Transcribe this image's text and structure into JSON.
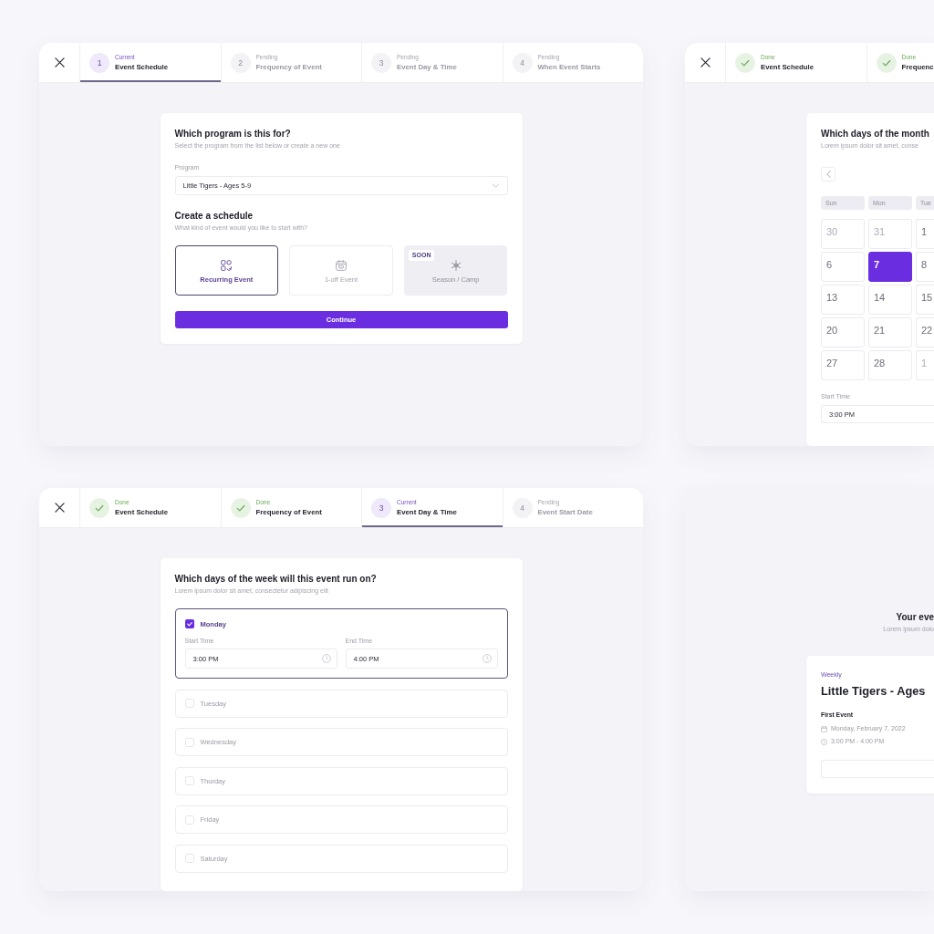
{
  "screens": [
    {
      "kind": "program",
      "steps": [
        {
          "done": false,
          "selected": true,
          "number": "1",
          "status": "Current",
          "label": "Event Schedule"
        },
        {
          "done": false,
          "selected": false,
          "number": "2",
          "status": "Pending",
          "label": "Frequency of Event"
        },
        {
          "done": false,
          "selected": false,
          "number": "3",
          "status": "Pending",
          "label": "Event Day & Time"
        },
        {
          "done": false,
          "selected": false,
          "number": "4",
          "status": "Pending",
          "label": "When Event Starts"
        }
      ],
      "title": "Which program is this for?",
      "subtitle": "Select the program from the list below or create a new one",
      "program": {
        "label": "Program",
        "value": "Little Tigers - Ages 5-9"
      },
      "schedule_title": "Create a schedule",
      "schedule_subtitle": "What kind of event would you like to start with?",
      "options": [
        {
          "kind": "recurring",
          "label": "Recurring Event",
          "selected": true,
          "disabled": false
        },
        {
          "kind": "single",
          "label": "1-off Event",
          "selected": false,
          "disabled": false
        },
        {
          "kind": "season",
          "label": "Season / Camp",
          "selected": false,
          "disabled": true,
          "badge": "SOON"
        }
      ],
      "button": "Continue"
    },
    {
      "kind": "month",
      "steps": [
        {
          "done": true,
          "selected": false,
          "status": "Done",
          "label": "Event Schedule"
        },
        {
          "done": true,
          "selected": false,
          "status": "Done",
          "label": "Frequenc"
        }
      ],
      "title": "Which days of the month",
      "subtitle": "Lorem ipsum dolor sit amet, conse",
      "weekdays": [
        "Sun",
        "Mon",
        "Tue"
      ],
      "weeks": [
        [
          {
            "day": "30",
            "outside_month": true,
            "selected": false
          },
          {
            "day": "31",
            "outside_month": true,
            "selected": false
          },
          {
            "day": "1",
            "outside_month": false,
            "selected": false
          }
        ],
        [
          {
            "day": "6",
            "outside_month": false,
            "selected": false
          },
          {
            "day": "7",
            "outside_month": false,
            "selected": true
          },
          {
            "day": "8",
            "outside_month": false,
            "selected": false
          }
        ],
        [
          {
            "day": "13",
            "outside_month": false,
            "selected": false
          },
          {
            "day": "14",
            "outside_month": false,
            "selected": false
          },
          {
            "day": "15",
            "outside_month": false,
            "selected": false
          }
        ],
        [
          {
            "day": "20",
            "outside_month": false,
            "selected": false
          },
          {
            "day": "21",
            "outside_month": false,
            "selected": false
          },
          {
            "day": "22",
            "outside_month": false,
            "selected": false
          }
        ],
        [
          {
            "day": "27",
            "outside_month": false,
            "selected": false
          },
          {
            "day": "28",
            "outside_month": false,
            "selected": false
          },
          {
            "day": "1",
            "outside_month": true,
            "selected": false
          }
        ]
      ],
      "start_time": {
        "label": "Start Time",
        "value": "3:00 PM"
      }
    },
    {
      "kind": "week",
      "steps": [
        {
          "done": true,
          "selected": false,
          "status": "Done",
          "label": "Event Schedule"
        },
        {
          "done": true,
          "selected": false,
          "status": "Done",
          "label": "Frequency of Event"
        },
        {
          "done": false,
          "selected": true,
          "number": "3",
          "status": "Current",
          "label": "Event Day & Time"
        },
        {
          "done": false,
          "selected": false,
          "number": "4",
          "status": "Pending",
          "label": "Event Start Date"
        }
      ],
      "title": "Which days of the week will this event run on?",
      "subtitle": "Lorem ipsum dolor sit amet, consectetur adipiscing elit",
      "days": [
        {
          "label": "Monday",
          "checked": true,
          "start_label": "Start Time",
          "start": "3:00 PM",
          "end_label": "End Time",
          "end": "4:00 PM"
        },
        {
          "label": "Tuesday",
          "checked": false
        },
        {
          "label": "Wednesday",
          "checked": false
        },
        {
          "label": "Thurday",
          "checked": false
        },
        {
          "label": "Friday",
          "checked": false
        },
        {
          "label": "Saturday",
          "checked": false
        }
      ]
    },
    {
      "kind": "summary",
      "title": "Your eve",
      "subtitle": "Lorem ipsum dolo",
      "event": {
        "frequency": "Weekly",
        "name": "Little Tigers - Ages",
        "first_label": "First Event",
        "date": "Monday, February 7, 2022",
        "time": "3:00 PM - 4:00 PM"
      }
    }
  ]
}
